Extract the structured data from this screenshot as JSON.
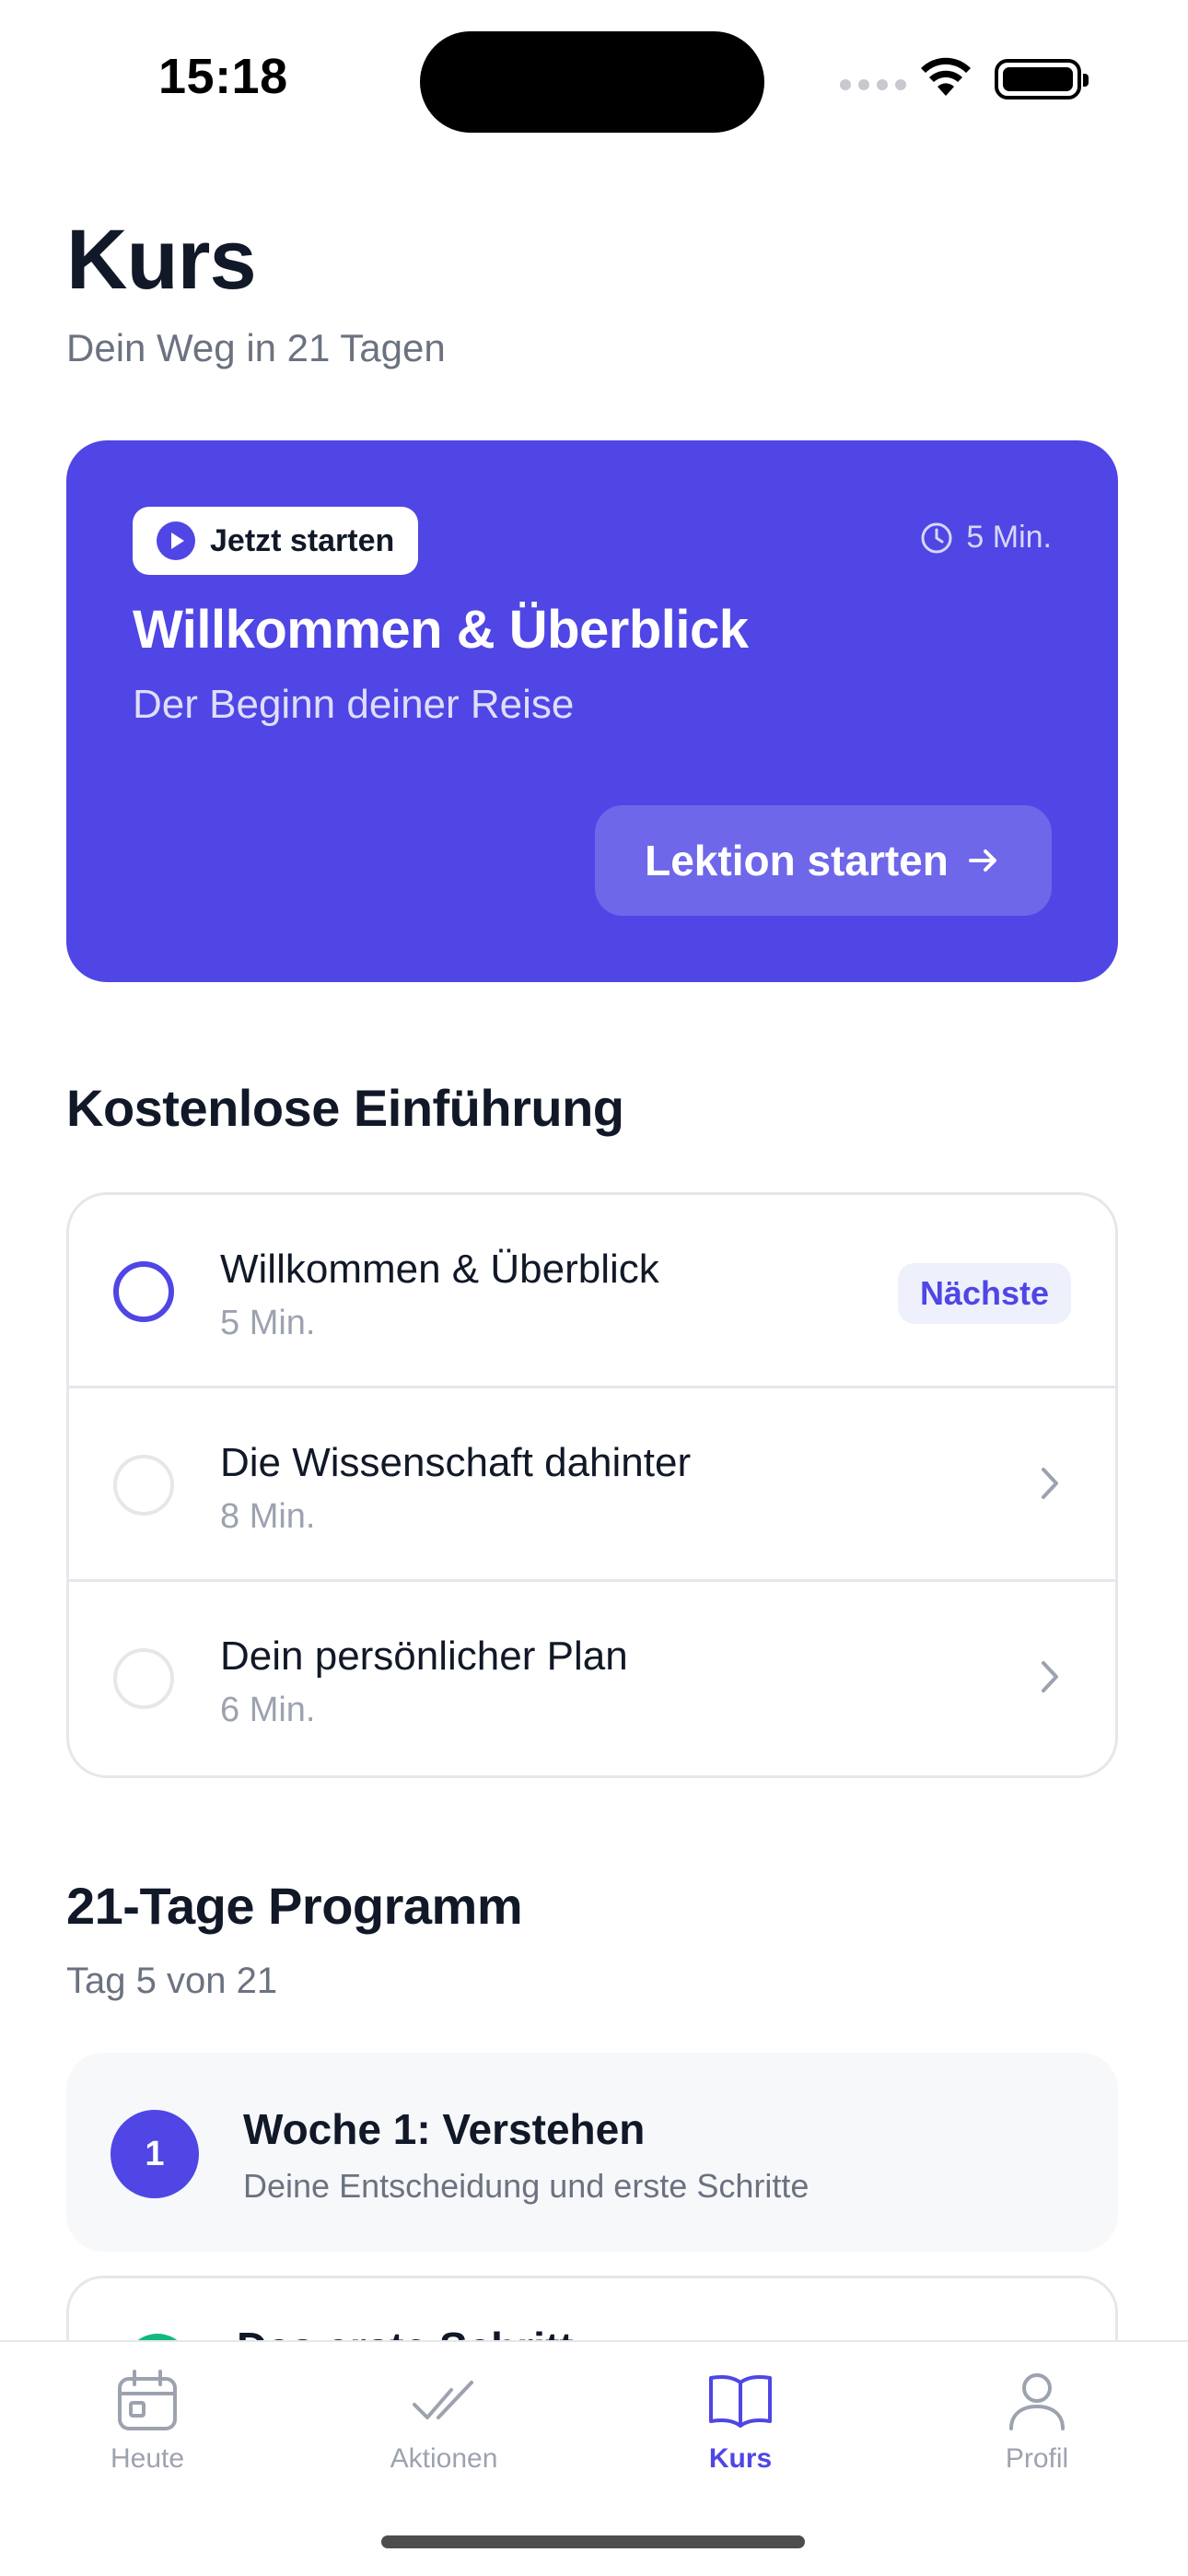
{
  "status_bar": {
    "time": "15:18"
  },
  "header": {
    "title": "Kurs",
    "subtitle": "Dein Weg in 21 Tagen"
  },
  "hero": {
    "badge": "Jetzt starten",
    "duration": "5 Min.",
    "title": "Willkommen & Überblick",
    "subtitle": "Der Beginn deiner Reise",
    "button": "Lektion starten",
    "accent": "#4f46e5"
  },
  "intro_section": {
    "title": "Kostenlose Einführung",
    "lessons": [
      {
        "title": "Willkommen & Überblick",
        "duration": "5 Min.",
        "badge": "Nächste"
      },
      {
        "title": "Die Wissenschaft dahinter",
        "duration": "8 Min."
      },
      {
        "title": "Dein persönlicher Plan",
        "duration": "6 Min."
      }
    ]
  },
  "program_section": {
    "title": "21-Tage Programm",
    "progress": "Tag 5 von 21",
    "week": {
      "number": "1",
      "title": "Woche 1: Verstehen",
      "description": "Deine Entscheidung und erste Schritte"
    },
    "partial_item": "Das erste Schritt"
  },
  "tab_bar": {
    "tabs": [
      {
        "label": "Heute",
        "icon": "calendar-icon"
      },
      {
        "label": "Aktionen",
        "icon": "double-check-icon"
      },
      {
        "label": "Kurs",
        "icon": "book-icon",
        "active": true
      },
      {
        "label": "Profil",
        "icon": "person-icon"
      }
    ]
  }
}
